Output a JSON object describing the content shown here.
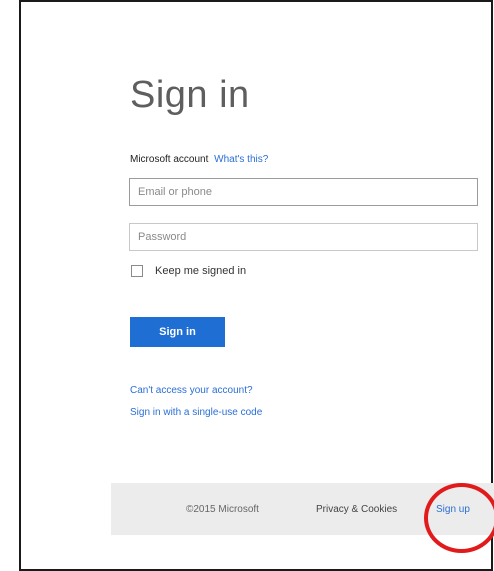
{
  "header": {
    "title": "Sign in"
  },
  "account": {
    "label": "Microsoft account",
    "help_link": "What's this?"
  },
  "form": {
    "email_placeholder": "Email or phone",
    "password_placeholder": "Password",
    "keep_signed_in_label": "Keep me signed in",
    "keep_signed_in_checked": false,
    "submit_label": "Sign in"
  },
  "help_links": [
    "Can't access your account?",
    "Sign in with a single-use code"
  ],
  "footer": {
    "copyright": "©2015 Microsoft",
    "privacy_label": "Privacy & Cookies",
    "signup_label": "Sign up"
  },
  "colors": {
    "accent": "#1f6ed4",
    "link": "#2b6fd6",
    "annotation": "#e11b1b",
    "footer_bg": "#ececec"
  }
}
